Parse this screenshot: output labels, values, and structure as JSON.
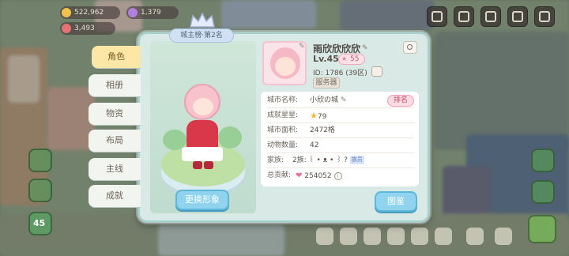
{
  "hud": {
    "gold": "522,962",
    "gems": "1,379",
    "energy": "3,493"
  },
  "toolbar": {
    "buttons": [
      "rank-list-icon",
      "camera-roll-icon",
      "mail-icon",
      "camera-icon",
      "settings-icon"
    ]
  },
  "modal": {
    "rank_badge": "城主榜·第2名",
    "tabs": [
      {
        "label": "角色",
        "active": true
      },
      {
        "label": "相册",
        "active": false
      },
      {
        "label": "物资",
        "active": false
      },
      {
        "label": "布局",
        "active": false
      },
      {
        "label": "主线",
        "active": false
      },
      {
        "label": "成就",
        "active": false
      }
    ],
    "change_appearance": "更换形象",
    "profile": {
      "name": "雨欣欣欣欣",
      "level": "Lv.45",
      "level_badge": "55",
      "id_line": "ID: 1786 (39区)",
      "server": "服务器"
    },
    "info": {
      "city_name_label": "城市名称:",
      "city_name_value": "小欣の城",
      "rank_button": "排名",
      "stars_label": "成就星星:",
      "stars_value": "79",
      "area_label": "城市面积:",
      "area_value": "2472格",
      "animals_label": "动物数量:",
      "animals_value": "42",
      "family_label": "家族:",
      "family_value": "2族: ꒰ • ᴥ • ꒱ ?",
      "family_tag": "族员",
      "contribution_label": "总贡献:",
      "contribution_value": "254052"
    },
    "atlas_button": "图鉴"
  },
  "side": {
    "level_badge": "45"
  },
  "colors": {
    "accent_blue": "#8fd3ee",
    "tab_active": "#fce7a6",
    "modal_bg": "#d8e9e6",
    "pink": "#ec6f8e"
  }
}
